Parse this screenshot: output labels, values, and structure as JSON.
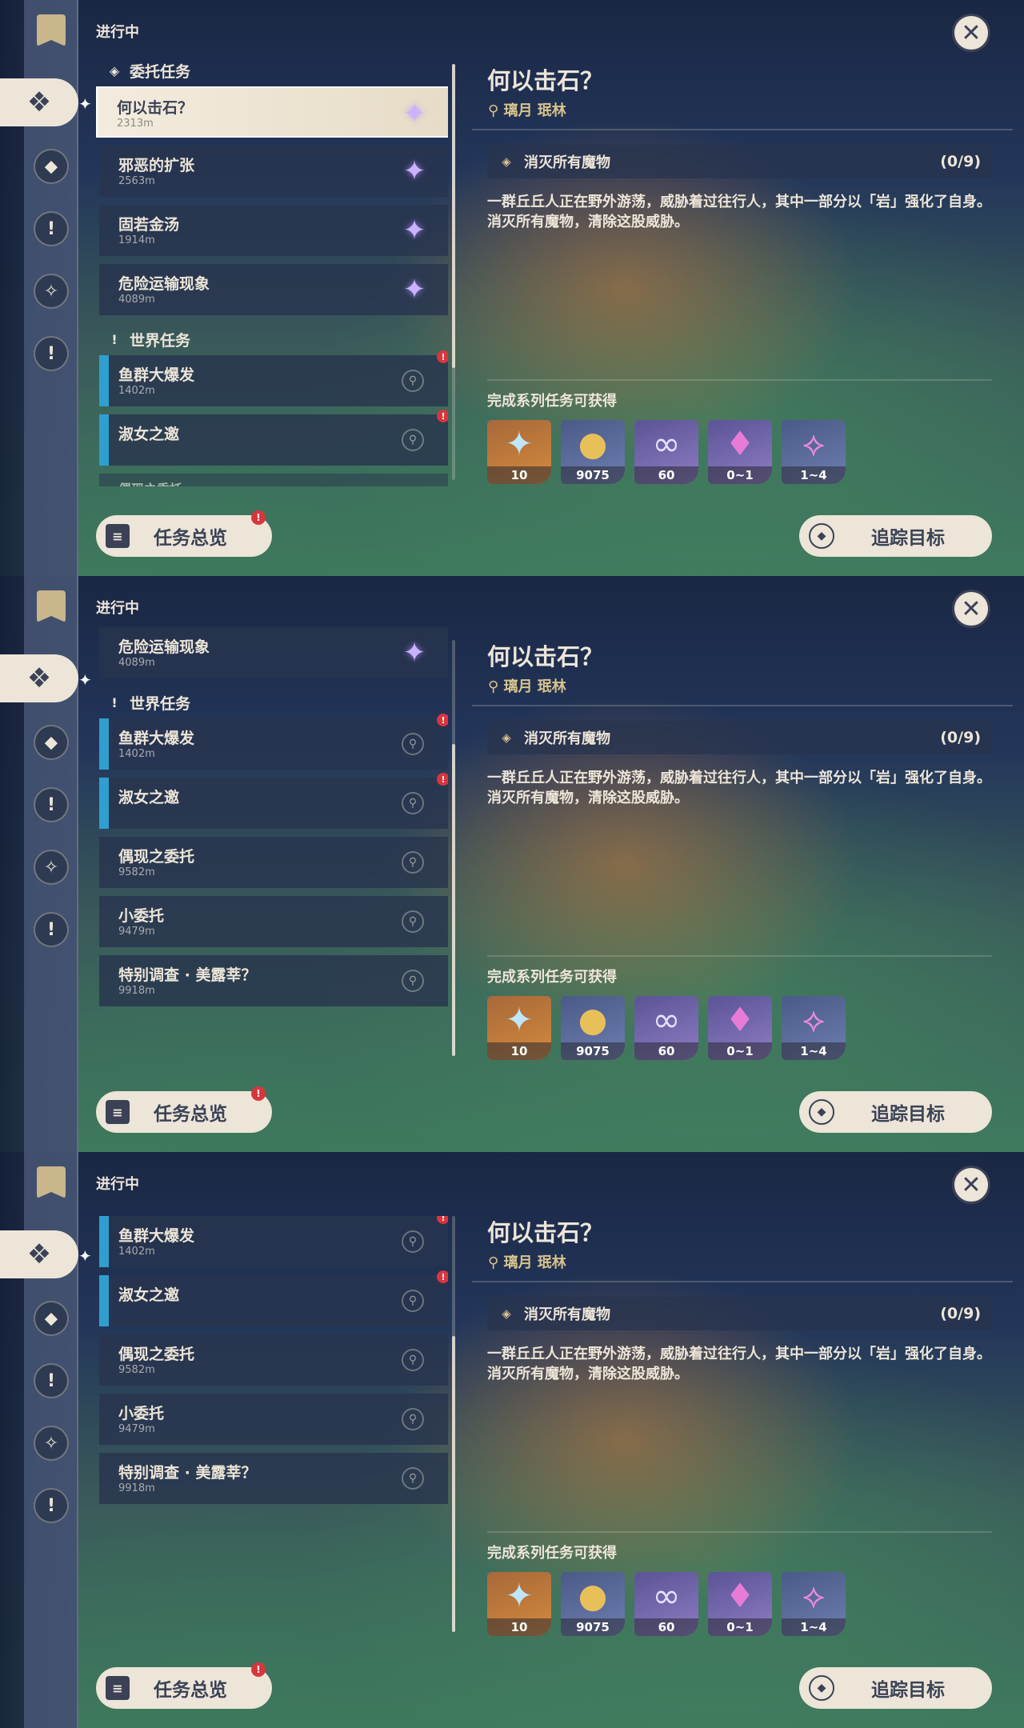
{
  "status": "进行中",
  "icons": {
    "quest_book": "bookmark-icon",
    "close": "close-icon",
    "commission": "commission-diamond-icon",
    "world": "exclamation-icon",
    "gem": "purple-star-gem-icon",
    "pin": "map-pin-icon"
  },
  "colors": {
    "cream": "#ece5d8",
    "navy": "#3b4256",
    "gold": "#d9c38e",
    "alert_red": "#d9353d",
    "world_blue": "#2f9fd0"
  },
  "sections": {
    "commission": "委托任务",
    "world": "世界任务"
  },
  "quests": {
    "q1": {
      "name": "何以击石？",
      "dist": "2313m"
    },
    "q2": {
      "name": "邪恶的扩张",
      "dist": "2563m"
    },
    "q3": {
      "name": "固若金汤",
      "dist": "1914m"
    },
    "q4": {
      "name": "危险运输现象",
      "dist": "4089m"
    },
    "w1": {
      "name": "鱼群大爆发",
      "dist": "1402m"
    },
    "w2": {
      "name": "淑女之邀",
      "dist": ""
    },
    "w3": {
      "name": "偶现之委托",
      "dist": "9582m"
    },
    "w4": {
      "name": "小委托",
      "dist": "9479m"
    },
    "w5": {
      "name": "特别调查 · 美露莘？",
      "dist": "9918m"
    }
  },
  "alert_mark": "!",
  "detail": {
    "title": "何以击石？",
    "location": "璃月 珉林",
    "objective": "消灭所有魔物",
    "progress": "(0/9)",
    "description": "一群丘丘人正在野外游荡，威胁着过往行人，其中一部分以「岩」强化了自身。消灭所有魔物，清除这股威胁。",
    "rewards_label": "完成系列任务可获得",
    "rewards": [
      {
        "icon": "primogem-icon",
        "count": "10"
      },
      {
        "icon": "mora-coin-icon",
        "count": "9075"
      },
      {
        "icon": "companionship-exp-icon",
        "count": "60"
      },
      {
        "icon": "purple-crystal-icon",
        "count": "0~1"
      },
      {
        "icon": "pink-crystal-cluster-icon",
        "count": "1~4"
      }
    ]
  },
  "buttons": {
    "overview": "任务总览",
    "track": "追踪目标"
  }
}
